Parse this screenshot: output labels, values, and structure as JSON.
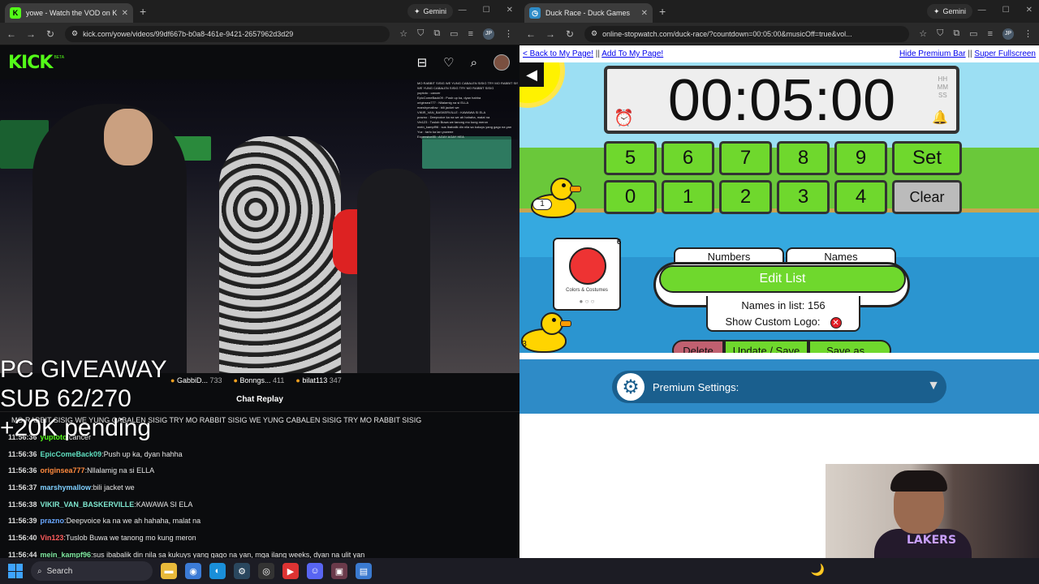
{
  "left_browser": {
    "tab_title": "yowe - Watch the VOD on K",
    "favicon": "K",
    "gemini_label": "Gemini",
    "url": "kick.com/yowe/videos/99df667b-b0a8-461e-9421-2657962d3d29",
    "kick": {
      "logo_text": "KICK",
      "beta": "BETA",
      "icons": [
        "library-icon",
        "heart-icon",
        "search-icon",
        "avatar"
      ]
    },
    "video_chat": [
      "MO RABBIT SISIG WE YUNG CABALEN SISIG TRY MO RABBIT SISIG",
      "WE YUNG CABALEN SISIG TRY MO RABBIT SISIG",
      "yuptoto : cancer",
      "EpicComeBack09 : Push up ka, dyan hahha",
      "originsea777 : Nllalamig na si ELLA",
      "marshymallow : bili jacket we",
      "VIKIR_VAN_BASKERVILLE : KAWAWA SI ELA",
      "prazno : Deepvoice ka na we ah hahaha, malat na",
      "Vin123 : Tuslob Buwa we tanong mo kung meron",
      "mein_kampf96 : sus ibabalik din nila sa kukuys yang gago na yan",
      "Yuz : tarlo ka lan yoweee",
      "Expensive85 : AGAY AGAY HEA"
    ],
    "overlay_lines": [
      "PC GIVEAWAY",
      "SUB 62/270",
      "+20K pending"
    ],
    "viewers": [
      {
        "name": "GabbiD...",
        "count": "733"
      },
      {
        "name": "Bonngs...",
        "count": "411"
      },
      {
        "name": "bilat113",
        "count": "347"
      }
    ],
    "chat_replay_title": "Chat Replay",
    "chat": [
      {
        "time": "",
        "user": "",
        "msg": "MO RABBIT SISIG WE YUNG CABALEN SISIG TRY MO RABBIT SISIG WE YUNG CABALEN SISIG TRY MO RABBIT SISIG",
        "color": "#e6e6e6"
      },
      {
        "time": "11:56:36",
        "user": "yuptoto",
        "msg": "cancer",
        "color": "#53fc18"
      },
      {
        "time": "11:56:36",
        "user": "EpicComeBack09",
        "msg": "Push up ka, dyan hahha",
        "color": "#5fe0c0"
      },
      {
        "time": "11:56:36",
        "user": "originsea777",
        "msg": "Nllalamig na si ELLA",
        "color": "#ff8a3d"
      },
      {
        "time": "11:56:37",
        "user": "marshymallow",
        "msg": "bili jacket we",
        "color": "#7fd0ff"
      },
      {
        "time": "11:56:38",
        "user": "VIKIR_VAN_BASKERVILLE",
        "msg": "KAWAWA SI ELA",
        "color": "#7fe8d0"
      },
      {
        "time": "11:56:39",
        "user": "prazno",
        "msg": "Deepvoice ka na we ah hahaha, malat na",
        "color": "#6aa8ff"
      },
      {
        "time": "11:56:40",
        "user": "Vin123",
        "msg": "Tuslob Buwa we tanong mo kung meron",
        "color": "#ff5c5c"
      },
      {
        "time": "11:56:44",
        "user": "mein_kampf96",
        "msg": "sus ibabalik din nila sa kukuys yang gago na yan, mga ilang weeks, dyan na ulit yan",
        "color": "#7fe8a0"
      }
    ]
  },
  "right_browser": {
    "tab_title": "Duck Race - Duck Games",
    "gemini_label": "Gemini",
    "url": "online-stopwatch.com/duck-race/?countdown=00:05:00&musicOff=true&vol...",
    "links": {
      "back": "< Back to My Page!",
      "sep1": "||",
      "add": "Add To My Page!",
      "hide": "Hide Premium Bar",
      "sep2": "||",
      "fullscreen": "Super Fullscreen"
    },
    "timer": "00:05:00",
    "hms": [
      "HH",
      "MM",
      "SS"
    ],
    "keys_row1": [
      "5",
      "6",
      "7",
      "8",
      "9",
      "Set"
    ],
    "keys_row2": [
      "0",
      "1",
      "2",
      "3",
      "4",
      "Clear"
    ],
    "duck_numbers": [
      "1",
      "3"
    ],
    "tabs": [
      "Numbers",
      "Names"
    ],
    "edit_list": "Edit List",
    "names_in_list": "Names in list: 156",
    "show_custom_logo": "Show Custom Logo:",
    "card_caption": "Colors & Costumes",
    "card_badge": "6",
    "actions": [
      "Delete",
      "Update / Save",
      "Save as..."
    ],
    "premium_settings": "Premium Settings:"
  },
  "webcam": {
    "shirt_text": "LAKERS"
  },
  "taskbar": {
    "search_label": "Search",
    "apps": [
      "file-explorer-icon",
      "chrome-icon",
      "edge-icon",
      "steam-icon",
      "obs-icon",
      "media-icon",
      "discord-icon",
      "app-icon",
      "notepad-icon"
    ]
  }
}
